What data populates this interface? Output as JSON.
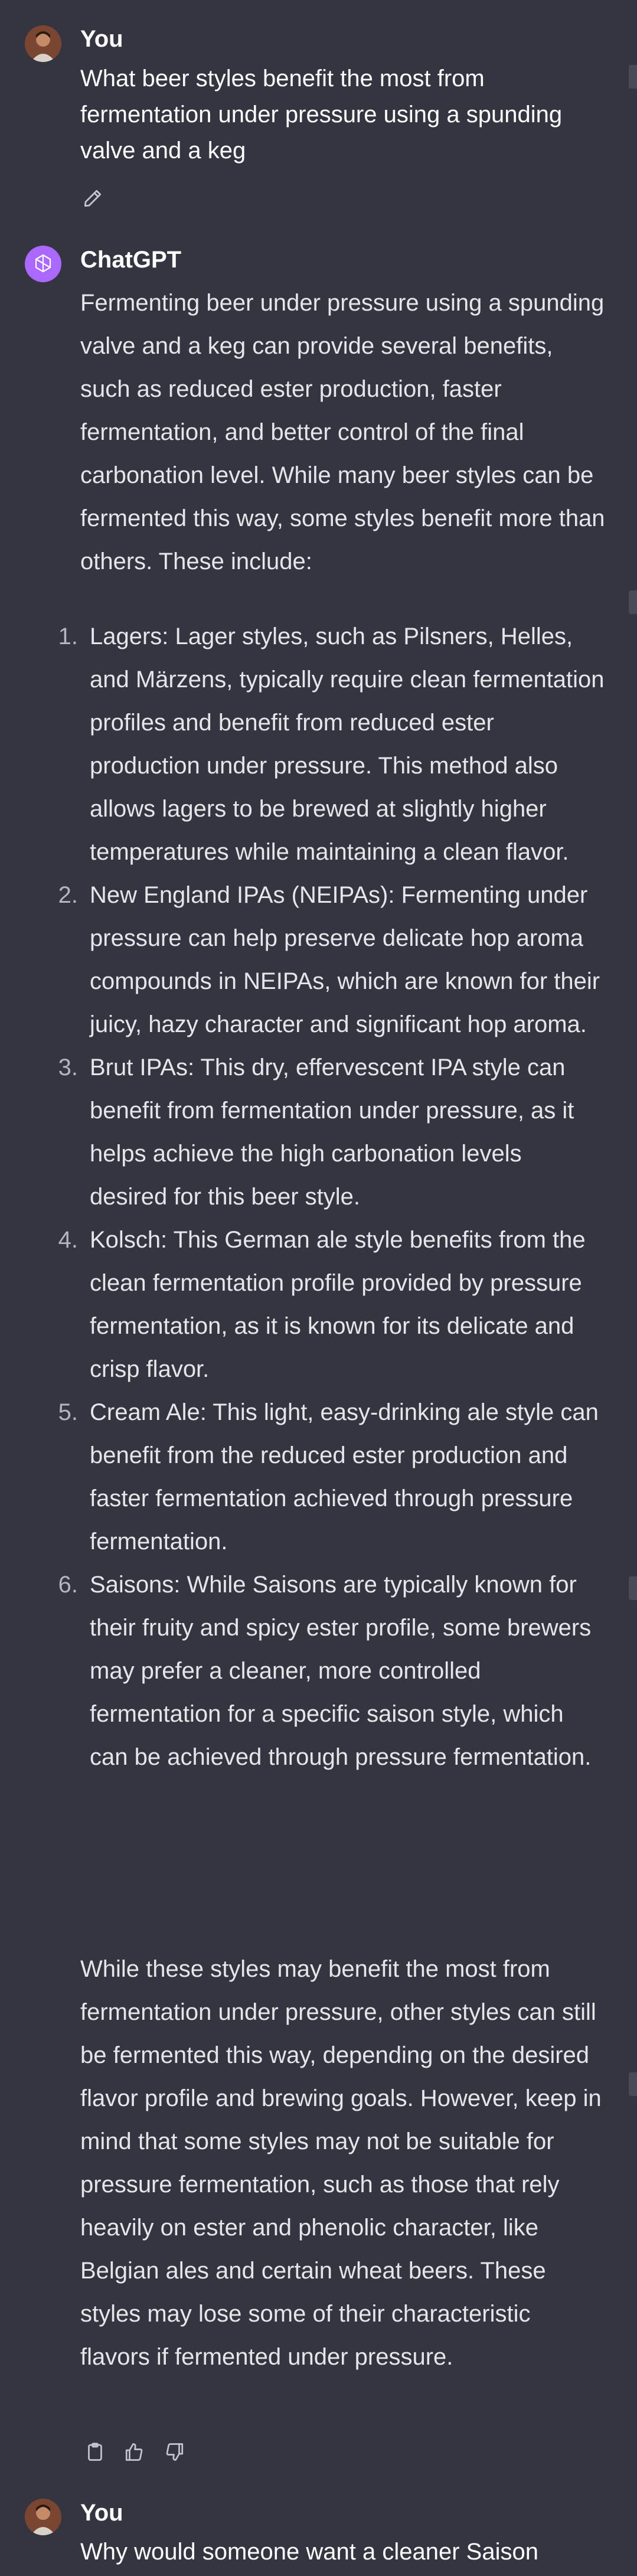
{
  "conversation": {
    "messages": [
      {
        "role": "user",
        "author": "You",
        "text": "What beer styles benefit the most from fermentation under pressure using a spunding valve and a keg"
      },
      {
        "role": "assistant",
        "author": "ChatGPT",
        "intro": "Fermenting beer under pressure using a spunding valve and a keg can provide several benefits, such as reduced ester production, faster fermentation, and better control of the final carbonation level. While many beer styles can be fermented this way, some styles benefit more than others. These include:",
        "items": [
          {
            "num": "1.",
            "text": "Lagers: Lager styles, such as Pilsners, Helles, and Märzens, typically require clean fermentation profiles and benefit from reduced ester production under pressure. This method also allows lagers to be brewed at slightly higher temperatures while maintaining a clean flavor."
          },
          {
            "num": "2.",
            "text": "New England IPAs (NEIPAs): Fermenting under pressure can help preserve delicate hop aroma compounds in NEIPAs, which are known for their juicy, hazy character and significant hop aroma."
          },
          {
            "num": "3.",
            "text": "Brut IPAs: This dry, effervescent IPA style can benefit from fermentation under pressure, as it helps achieve the high carbonation levels desired for this beer style."
          },
          {
            "num": "4.",
            "text": "Kolsch: This German ale style benefits from the clean fermentation profile provided by pressure fermentation, as it is known for its delicate and crisp flavor."
          },
          {
            "num": "5.",
            "text": "Cream Ale: This light, easy-drinking ale style can benefit from the reduced ester production and faster fermentation achieved through pressure fermentation."
          },
          {
            "num": "6.",
            "text": "Saisons: While Saisons are typically known for their fruity and spicy ester profile, some brewers may prefer a cleaner, more controlled fermentation for a specific saison style, which can be achieved through pressure fermentation."
          }
        ],
        "outro": "While these styles may benefit the most from fermentation under pressure, other styles can still be fermented this way, depending on the desired flavor profile and brewing goals. However, keep in mind that some styles may not be suitable for pressure fermentation, such as those that rely heavily on ester and phenolic character, like Belgian ales and certain wheat beers. These styles may lose some of their characteristic flavors if fermented under pressure."
      },
      {
        "role": "user",
        "author": "You",
        "text": "Why would someone want a cleaner Saison"
      }
    ]
  },
  "icons": {
    "edit": "pencil-icon",
    "copy": "clipboard-icon",
    "like": "thumbs-up-icon",
    "dislike": "thumbs-down-icon",
    "assistant_avatar": "openai-logo-icon"
  },
  "colors": {
    "background": "#343541",
    "assistant_avatar": "#ab68ff",
    "text": "#ececf1"
  }
}
